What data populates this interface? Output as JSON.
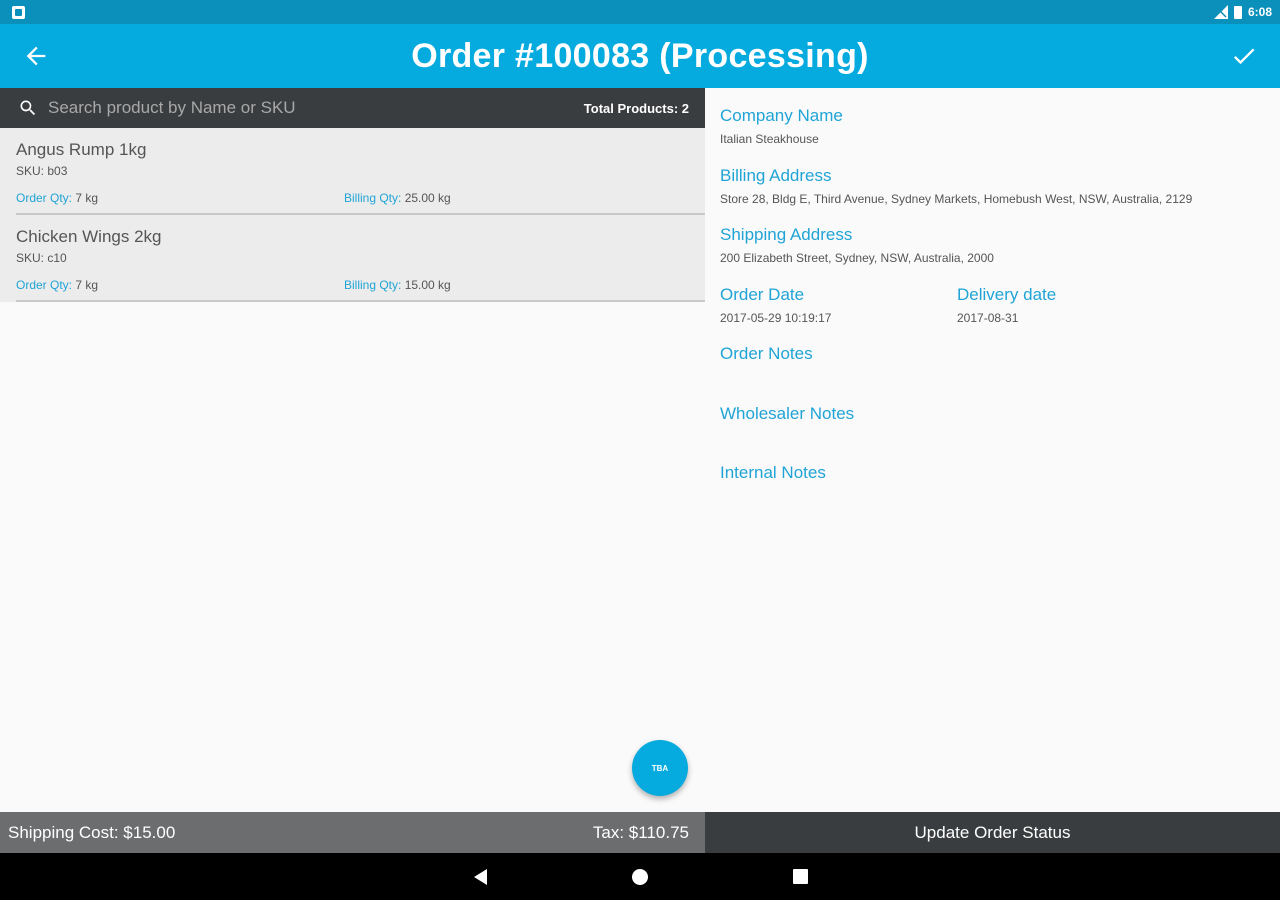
{
  "status_bar": {
    "time": "6:08"
  },
  "app_bar": {
    "title": "Order #100083 (Processing)",
    "back_icon": "arrow-left-icon",
    "confirm_icon": "check-icon"
  },
  "search": {
    "placeholder": "Search product by Name or SKU",
    "total_label": "Total Products: 2"
  },
  "products": [
    {
      "name": "Angus Rump 1kg",
      "sku": "SKU: b03",
      "order_qty_label": "Order Qty:",
      "order_qty": " 7 kg",
      "billing_qty_label": "Billing Qty:",
      "billing_qty": " 25.00 kg"
    },
    {
      "name": "Chicken Wings 2kg",
      "sku": "SKU: c10",
      "order_qty_label": "Order Qty:",
      "order_qty": " 7 kg",
      "billing_qty_label": "Billing Qty:",
      "billing_qty": " 15.00 kg"
    }
  ],
  "fab": {
    "label": "TBA"
  },
  "details": {
    "company": {
      "label": "Company Name",
      "value": "Italian Steakhouse"
    },
    "billing": {
      "label": "Billing Address",
      "value": "Store 28, Bldg E, Third Avenue,  Sydney Markets, Homebush West, NSW, Australia, 2129"
    },
    "shipping": {
      "label": "Shipping Address",
      "value": "200 Elizabeth Street, Sydney, NSW, Australia, 2000"
    },
    "order_date": {
      "label": "Order Date",
      "value": "2017-05-29 10:19:17"
    },
    "delivery_date": {
      "label": "Delivery date",
      "value": "2017-08-31"
    },
    "order_notes": {
      "label": "Order Notes",
      "value": ""
    },
    "wholesaler_notes": {
      "label": "Wholesaler Notes",
      "value": ""
    },
    "internal_notes": {
      "label": "Internal Notes",
      "value": ""
    }
  },
  "footer": {
    "shipping_cost": "Shipping Cost:  $15.00",
    "tax": "Tax:  $110.75",
    "update_button": "Update Order Status"
  },
  "colors": {
    "primary": "#05aadf",
    "status_bar": "#0a90bb",
    "label_blue": "#20a4d6",
    "dark_bar": "#3a3d3f"
  }
}
